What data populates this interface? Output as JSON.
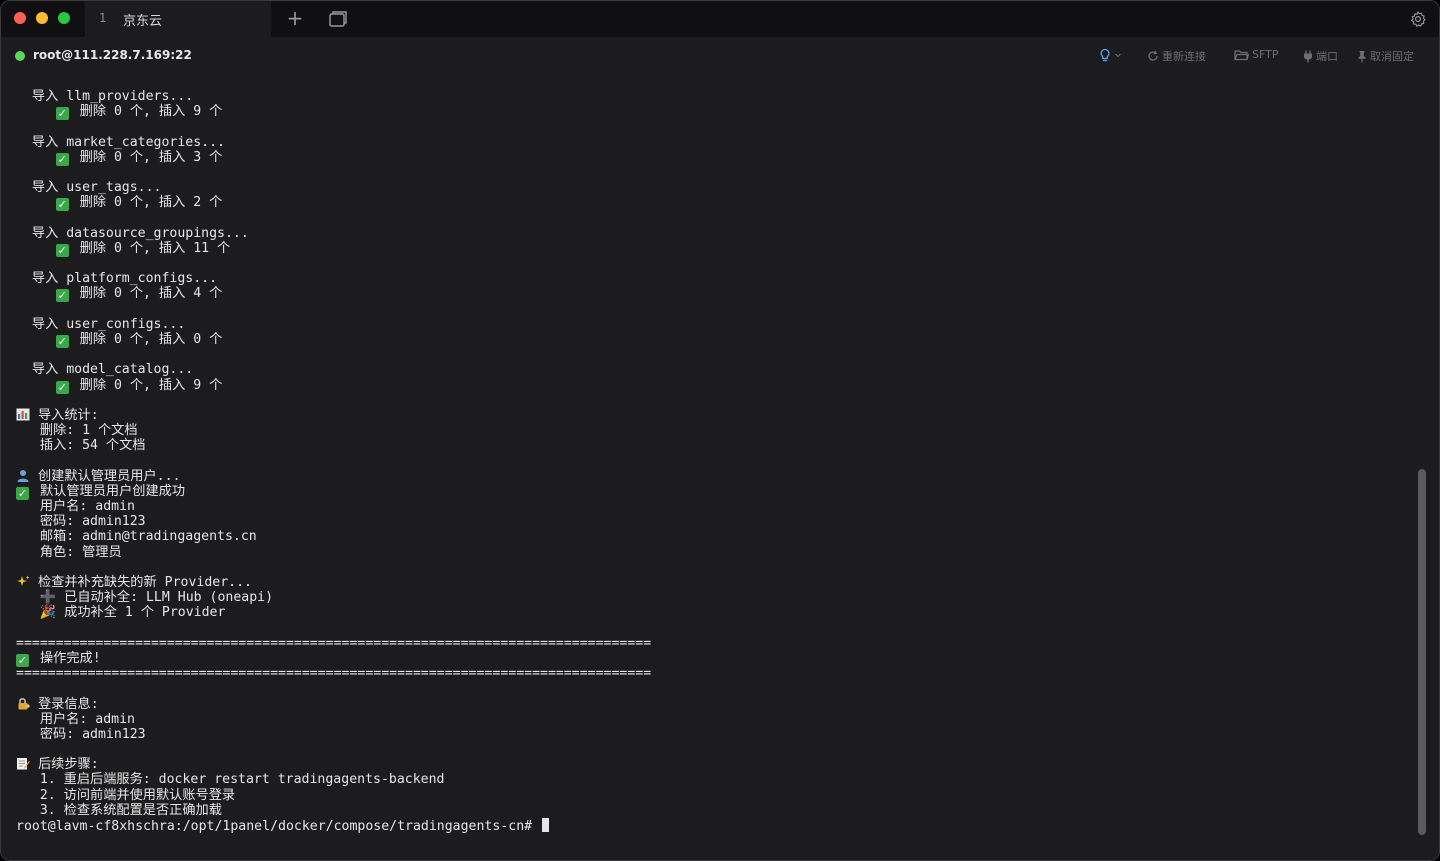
{
  "window": {
    "tab_number": "1",
    "tab_title": "京东云",
    "new_tab_icon": "plus-icon",
    "duplicate_icon": "duplicate-window-icon",
    "settings_icon": "gear-icon"
  },
  "connection": {
    "host": "root@111.228.7.169:22",
    "status_color": "#5fd35b"
  },
  "toolbar": {
    "hint_icon": "lightbulb-icon",
    "reconnect": "重新连接",
    "sftp": "SFTP",
    "port": "端口",
    "unpin": "取消固定"
  },
  "terminal": {
    "lines": [
      {
        "icon": "",
        "text": "  导入 llm_providers..."
      },
      {
        "icon": "check",
        "indent": "     ",
        "text": "删除 0 个, 插入 9 个"
      },
      {
        "icon": "",
        "text": ""
      },
      {
        "icon": "",
        "text": "  导入 market_categories..."
      },
      {
        "icon": "check",
        "indent": "     ",
        "text": "删除 0 个, 插入 3 个"
      },
      {
        "icon": "",
        "text": ""
      },
      {
        "icon": "",
        "text": "  导入 user_tags..."
      },
      {
        "icon": "check",
        "indent": "     ",
        "text": "删除 0 个, 插入 2 个"
      },
      {
        "icon": "",
        "text": ""
      },
      {
        "icon": "",
        "text": "  导入 datasource_groupings..."
      },
      {
        "icon": "check",
        "indent": "     ",
        "text": "删除 0 个, 插入 11 个"
      },
      {
        "icon": "",
        "text": ""
      },
      {
        "icon": "",
        "text": "  导入 platform_configs..."
      },
      {
        "icon": "check",
        "indent": "     ",
        "text": "删除 0 个, 插入 4 个"
      },
      {
        "icon": "",
        "text": ""
      },
      {
        "icon": "",
        "text": "  导入 user_configs..."
      },
      {
        "icon": "check",
        "indent": "     ",
        "text": "删除 0 个, 插入 0 个"
      },
      {
        "icon": "",
        "text": ""
      },
      {
        "icon": "",
        "text": "  导入 model_catalog..."
      },
      {
        "icon": "check",
        "indent": "     ",
        "text": "删除 0 个, 插入 9 个"
      },
      {
        "icon": "",
        "text": ""
      },
      {
        "icon": "chart",
        "text": "导入统计:"
      },
      {
        "icon": "",
        "text": "   删除: 1 个文档"
      },
      {
        "icon": "",
        "text": "   插入: 54 个文档"
      },
      {
        "icon": "",
        "text": ""
      },
      {
        "icon": "user",
        "text": "创建默认管理员用户..."
      },
      {
        "icon": "check",
        "text": "默认管理员用户创建成功"
      },
      {
        "icon": "",
        "text": "   用户名: admin"
      },
      {
        "icon": "",
        "text": "   密码: admin123"
      },
      {
        "icon": "",
        "text": "   邮箱: admin@tradingagents.cn"
      },
      {
        "icon": "",
        "text": "   角色: 管理员"
      },
      {
        "icon": "",
        "text": ""
      },
      {
        "icon": "sparkle",
        "text": "检查并补充缺失的新 Provider..."
      },
      {
        "icon": "",
        "text": "   ➕ 已自动补全: LLM Hub (oneapi)"
      },
      {
        "icon": "",
        "text": "   🎉 成功补全 1 个 Provider"
      },
      {
        "icon": "",
        "text": ""
      },
      {
        "icon": "",
        "text": "================================================================================"
      },
      {
        "icon": "check",
        "text": "操作完成!"
      },
      {
        "icon": "",
        "text": "================================================================================"
      },
      {
        "icon": "",
        "text": ""
      },
      {
        "icon": "lock",
        "text": "登录信息:"
      },
      {
        "icon": "",
        "text": "   用户名: admin"
      },
      {
        "icon": "",
        "text": "   密码: admin123"
      },
      {
        "icon": "",
        "text": ""
      },
      {
        "icon": "memo",
        "text": "后续步骤:"
      },
      {
        "icon": "",
        "text": "   1. 重启后端服务: docker restart tradingagents-backend"
      },
      {
        "icon": "",
        "text": "   2. 访问前端并使用默认账号登录"
      },
      {
        "icon": "",
        "text": "   3. 检查系统配置是否正确加载"
      },
      {
        "icon": "",
        "text": "root@lavm-cf8xhschra:/opt/1panel/docker/compose/tradingagents-cn# ",
        "cursor": true
      }
    ]
  }
}
